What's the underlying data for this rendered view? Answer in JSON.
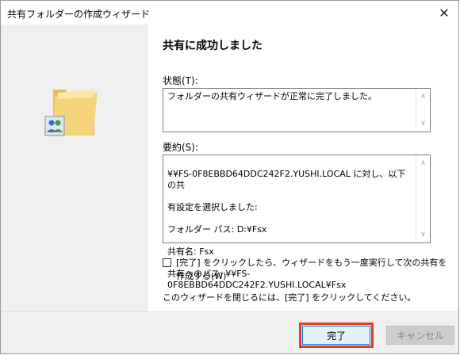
{
  "window": {
    "title": "共有フォルダーの作成ウィザード",
    "close_glyph": "✕"
  },
  "content": {
    "heading": "共有に成功しました",
    "status_label": "状態(T):",
    "status_text": "フォルダーの共有ウィザードが正常に完了しました。",
    "summary_label": "要約(S):",
    "summary_lines": [
      "¥¥FS-0F8EBBD64DDC242F2.YUSHI.LOCAL に対し、以下の共",
      "有設定を選択しました:",
      "フォルダー パス: D:¥Fsx",
      "共有名: Fsx",
      "共有へのパス: ¥¥FS-0F8EBBD64DDC242F2.YUSHI.LOCAL¥Fsx"
    ],
    "checkbox_label": "[完了] をクリックしたら、ウィザードをもう一度実行して次の共有を作成する(W)",
    "close_note": "このウィザードを閉じるには、[完了] をクリックしてください。"
  },
  "footer": {
    "finish_label": "完了",
    "cancel_label": "キャンセル"
  },
  "colors": {
    "highlight": "#e03a2a",
    "folder": "#f5d37a"
  },
  "icons": [
    "folder-icon",
    "users-icon",
    "scroll-up-icon",
    "scroll-down-icon"
  ]
}
